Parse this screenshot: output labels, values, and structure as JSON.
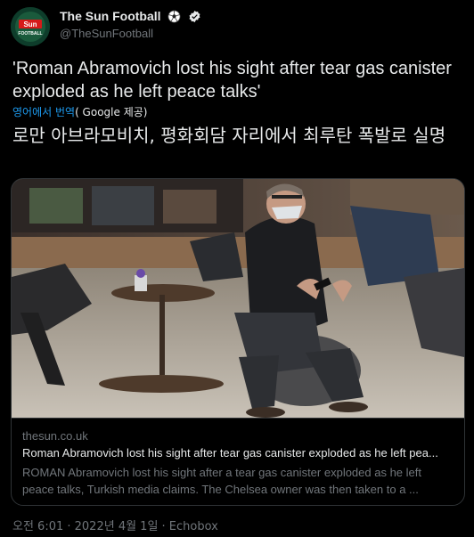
{
  "author": {
    "name": "The Sun Football",
    "handle": "@TheSunFootball",
    "avatar_text": "SUN FOOTBALL",
    "badges": [
      "soccer-ball-icon",
      "verified-icon"
    ]
  },
  "tweet": {
    "text": "'Roman Abramovich lost his sight after tear gas canister exploded as he left peace talks'",
    "translate_label": "영어에서 번역",
    "translate_provider": "( Google 제공)",
    "translated_text": "로만 아브라모비치, 평화회담 자리에서 최루탄 폭발로 실명"
  },
  "card": {
    "domain": "thesun.co.uk",
    "title": "Roman Abramovich lost his sight after tear gas canister exploded as he left pea...",
    "description": "ROMAN Abramovich lost his sight after a tear gas canister exploded as he left peace talks, Turkish media claims. The Chelsea owner was then taken to a ..."
  },
  "meta": {
    "line": "오전 6:01 · 2022년 4월 1일 · Echobox"
  },
  "colors": {
    "background": "#000000",
    "link": "#1d9bf0",
    "secondary": "#71767b",
    "verified": "#e7e9ea"
  }
}
